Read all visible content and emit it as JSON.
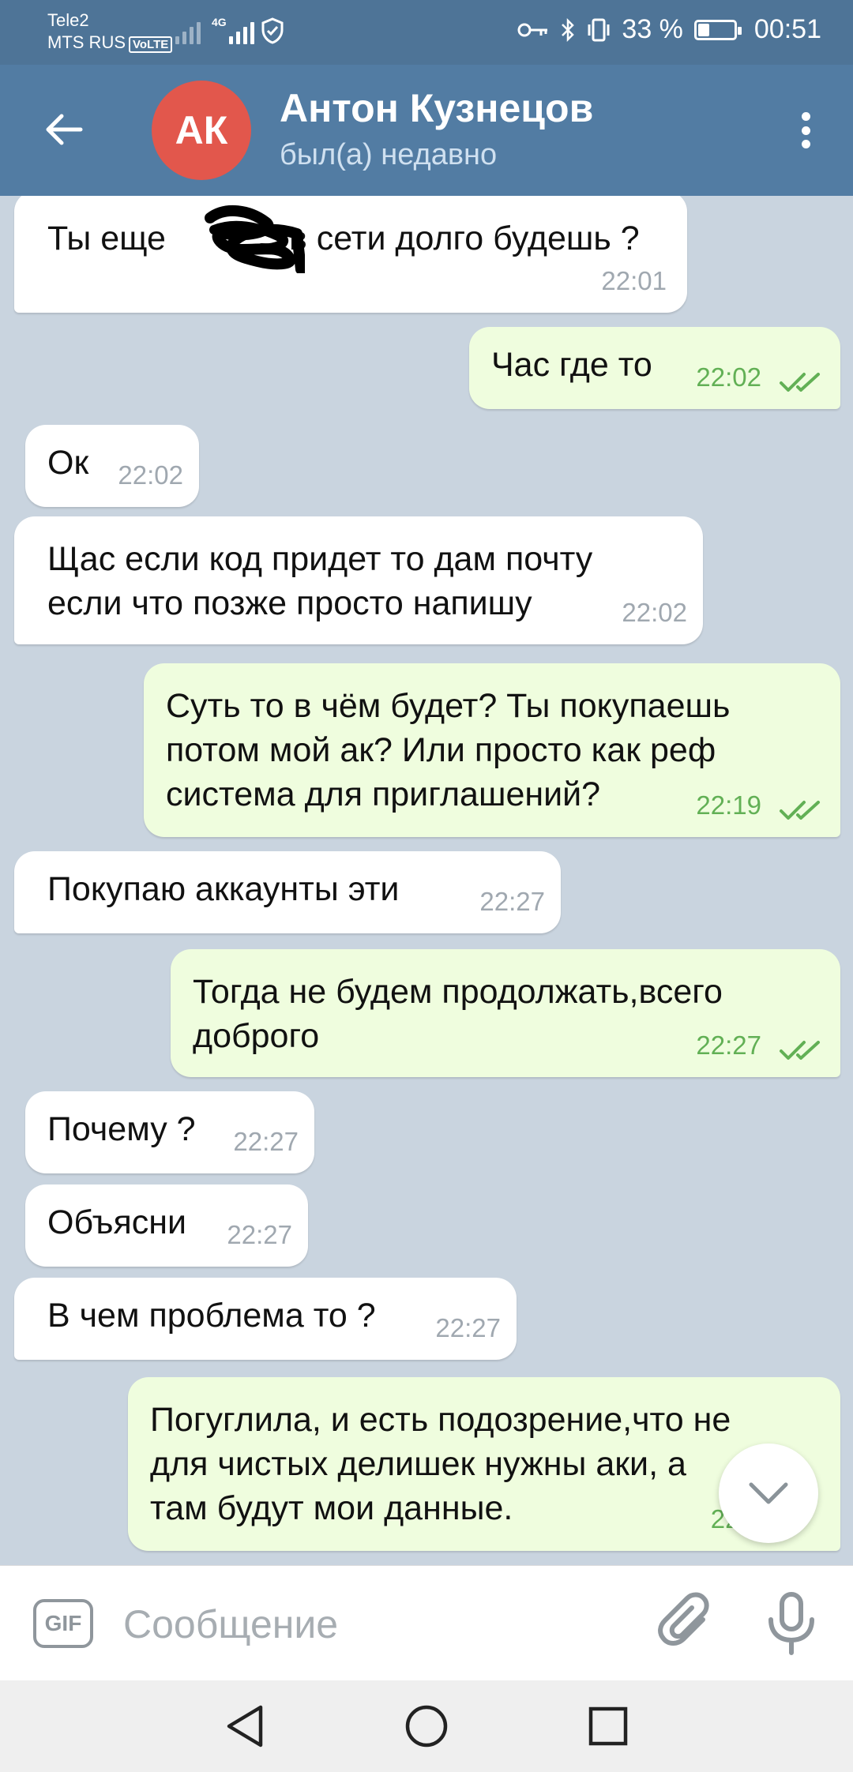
{
  "status_bar": {
    "carrier1": "Tele2",
    "carrier2": "MTS RUS",
    "volte": "VoLTE",
    "network": "4G",
    "battery_text": "33 %",
    "battery_level": 0.33,
    "clock": "00:51"
  },
  "header": {
    "avatar_initials": "АК",
    "avatar_color": "#e2574c",
    "name": "Антон Кузнецов",
    "status": "был(а) недавно"
  },
  "messages": [
    {
      "dir": "in",
      "text1": "Ты еще",
      "text2": "в сети долго будешь ?",
      "time": "22:01"
    },
    {
      "dir": "out",
      "text": "Час где то",
      "time": "22:02"
    },
    {
      "dir": "in",
      "text": "Ок",
      "time": "22:02"
    },
    {
      "dir": "in",
      "line1": "Щас если код придет то дам почту",
      "line2": "если что позже просто напишу",
      "time": "22:02"
    },
    {
      "dir": "out",
      "line1": "Суть то в чём будет? Ты покупаешь",
      "line2": "потом мой ак? Или просто как реф",
      "line3": "система для приглашений?",
      "time": "22:19"
    },
    {
      "dir": "in",
      "text": "Покупаю аккаунты эти",
      "time": "22:27"
    },
    {
      "dir": "out",
      "line1": "Тогда не будем продолжать,всего",
      "line2": "доброго",
      "time": "22:27"
    },
    {
      "dir": "in",
      "text": "Почему ?",
      "time": "22:27"
    },
    {
      "dir": "in",
      "text": "Объясни",
      "time": "22:27"
    },
    {
      "dir": "in",
      "text": "В чем проблема то ?",
      "time": "22:27"
    },
    {
      "dir": "out",
      "line1": "Погуглила, и есть подозрение,что не",
      "line2": "для чистых делишек нужны аки, а",
      "line3": "там будут мои данные.",
      "time": "22:3"
    }
  ],
  "input": {
    "gif_label": "GIF",
    "placeholder": "Сообщение"
  },
  "colors": {
    "header_bg": "#527ca3",
    "outgoing_bubble": "#effdde",
    "incoming_bubble": "#ffffff",
    "read_check": "#62b055"
  },
  "icons": [
    "back-arrow-icon",
    "more-vertical-icon",
    "double-check-icon",
    "chevron-down-icon",
    "paperclip-icon",
    "microphone-icon",
    "nav-back-icon",
    "nav-home-icon",
    "nav-recent-icon"
  ]
}
